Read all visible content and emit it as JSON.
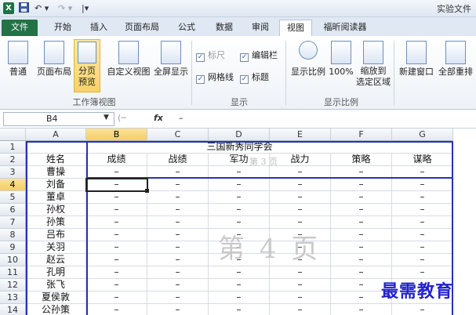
{
  "window": {
    "title": "实验文件"
  },
  "quick_access": {
    "undo": "↶ ▾",
    "redo": "↷ ▾",
    "customize": "|▾"
  },
  "tabs": [
    {
      "label": "文件"
    },
    {
      "label": "开始"
    },
    {
      "label": "插入"
    },
    {
      "label": "页面布局"
    },
    {
      "label": "公式"
    },
    {
      "label": "数据"
    },
    {
      "label": "审阅"
    },
    {
      "label": "视图"
    },
    {
      "label": "福昕阅读器"
    }
  ],
  "ribbon": {
    "workbook_views": {
      "label": "工作簿视图",
      "normal": "普通",
      "page_layout": "页面布局",
      "page_break_1": "分页",
      "page_break_2": "预览",
      "custom_views": "自定义视图",
      "full_screen": "全屏显示"
    },
    "show": {
      "label": "显示",
      "ruler": "标尺",
      "formula_bar": "编辑栏",
      "gridlines": "网格线",
      "headings": "标题"
    },
    "zoom": {
      "label": "显示比例",
      "zoom": "显示比例",
      "hundred": "100%",
      "zoom_sel_1": "缩放到",
      "zoom_sel_2": "选定区域"
    },
    "window": {
      "new_window": "新建窗口",
      "arrange_all": "全部重排"
    }
  },
  "formula_bar": {
    "name_box": "B4",
    "fx": "fx",
    "content": "–"
  },
  "sheet": {
    "columns": [
      "A",
      "B",
      "C",
      "D",
      "E",
      "F",
      "G"
    ],
    "rows": [
      "1",
      "2",
      "3",
      "4",
      "5",
      "6",
      "7",
      "8",
      "9",
      "10",
      "11",
      "12",
      "13",
      "14"
    ],
    "title": "三国新秀同学会",
    "headers": [
      "姓名",
      "成绩",
      "战绩",
      "军功",
      "战力",
      "策略",
      "谋略"
    ],
    "names": [
      "曹操",
      "刘备",
      "董卓",
      "孙权",
      "孙策",
      "吕布",
      "关羽",
      "赵云",
      "孔明",
      "张飞",
      "夏侯敦",
      "公孙策"
    ],
    "dash": "–"
  },
  "watermark": {
    "main": "第 4 页",
    "small": "第 3 页"
  },
  "brand": "最需教育",
  "colors": {
    "file_tab": "#217346",
    "page_break_line": "#2633b0",
    "selected_header": "#f5cf63",
    "brand": "#2222cc"
  }
}
